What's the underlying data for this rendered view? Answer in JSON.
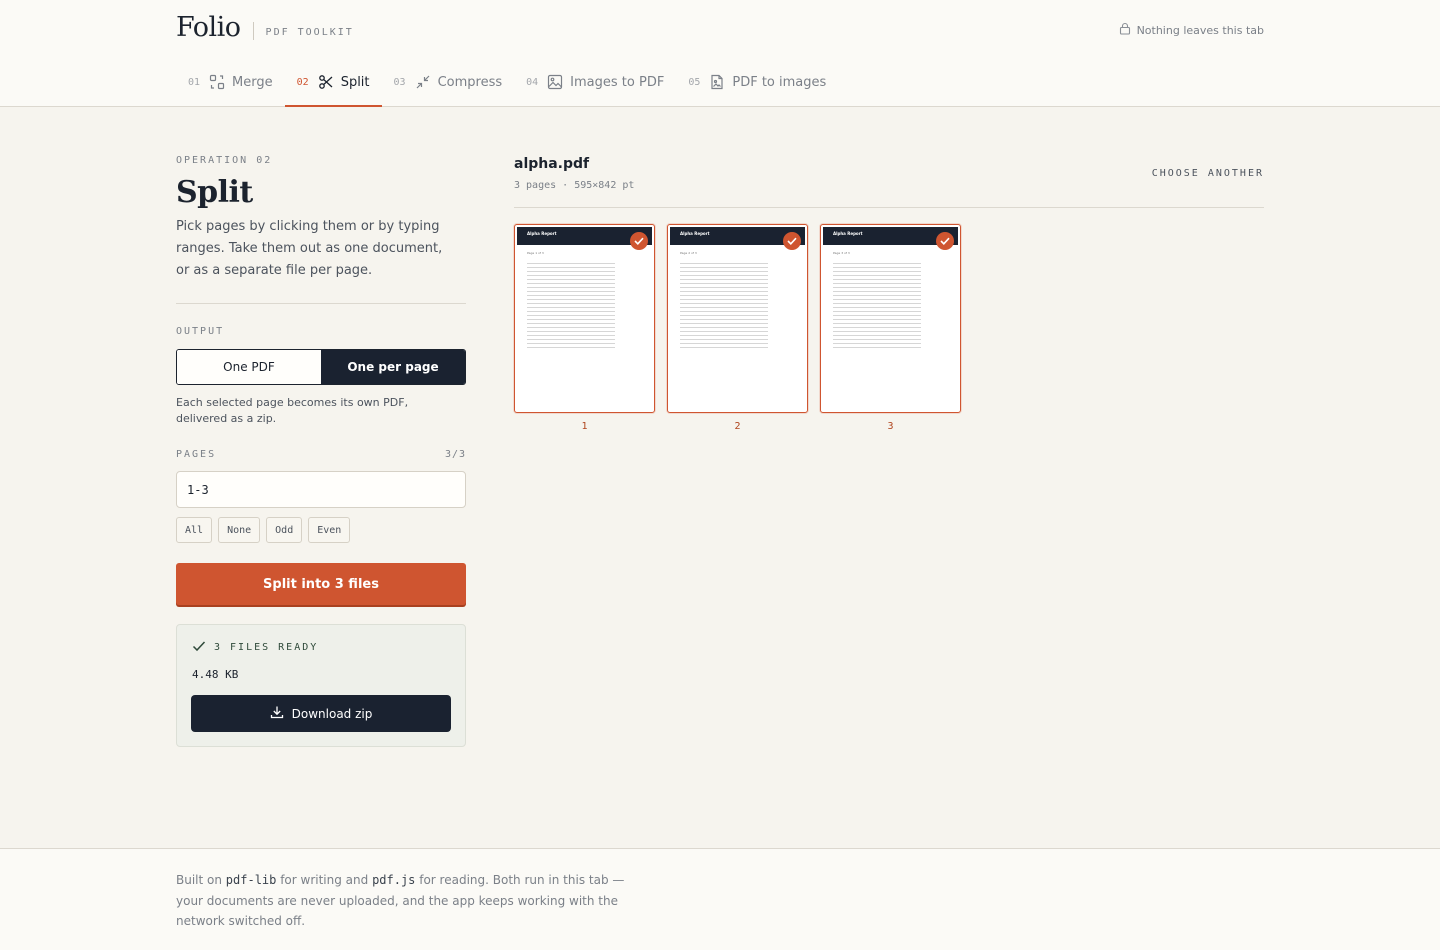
{
  "app": {
    "name": "Folio",
    "subtitle": "PDF TOOLKIT",
    "privacy_note": "Nothing leaves this tab"
  },
  "tabs": [
    {
      "num": "01",
      "label": "Merge",
      "icon": "merge-icon"
    },
    {
      "num": "02",
      "label": "Split",
      "icon": "scissors-icon",
      "active": true
    },
    {
      "num": "03",
      "label": "Compress",
      "icon": "compress-icon"
    },
    {
      "num": "04",
      "label": "Images to PDF",
      "icon": "image-icon"
    },
    {
      "num": "05",
      "label": "PDF to images",
      "icon": "file-image-icon"
    }
  ],
  "operation": {
    "kicker": "OPERATION 02",
    "title": "Split",
    "description": "Pick pages by clicking them or by typing ranges. Take them out as one document, or as a separate file per page."
  },
  "output": {
    "label": "OUTPUT",
    "options": [
      "One PDF",
      "One per page"
    ],
    "selected": "One per page",
    "help": "Each selected page becomes its own PDF, delivered as a zip."
  },
  "pages": {
    "label": "PAGES",
    "count": "3/3",
    "range_value": "1-3",
    "quick_select": [
      "All",
      "None",
      "Odd",
      "Even"
    ]
  },
  "action": {
    "label": "Split into 3 files"
  },
  "result": {
    "status": "3 FILES READY",
    "size": "4.48 KB",
    "download_label": "Download zip"
  },
  "file": {
    "name": "alpha.pdf",
    "meta": "3 pages · 595×842 pt",
    "choose_another": "CHOOSE ANOTHER"
  },
  "thumbnails": [
    {
      "number": "1",
      "header": "Alpha Report",
      "sub": "Page 1 of 3",
      "selected": true
    },
    {
      "number": "2",
      "header": "Alpha Report",
      "sub": "Page 2 of 3",
      "selected": true
    },
    {
      "number": "3",
      "header": "Alpha Report",
      "sub": "Page 3 of 3",
      "selected": true
    }
  ],
  "footer": {
    "prefix": "Built on ",
    "lib1": "pdf-lib",
    "mid1": " for writing and ",
    "lib2": "pdf.js",
    "rest": " for reading. Both run in this tab — your documents are never uploaded, and the app keeps working with the network switched off."
  },
  "colors": {
    "accent": "#cf5530",
    "ink": "#1a2230",
    "background": "#f6f4ee"
  }
}
